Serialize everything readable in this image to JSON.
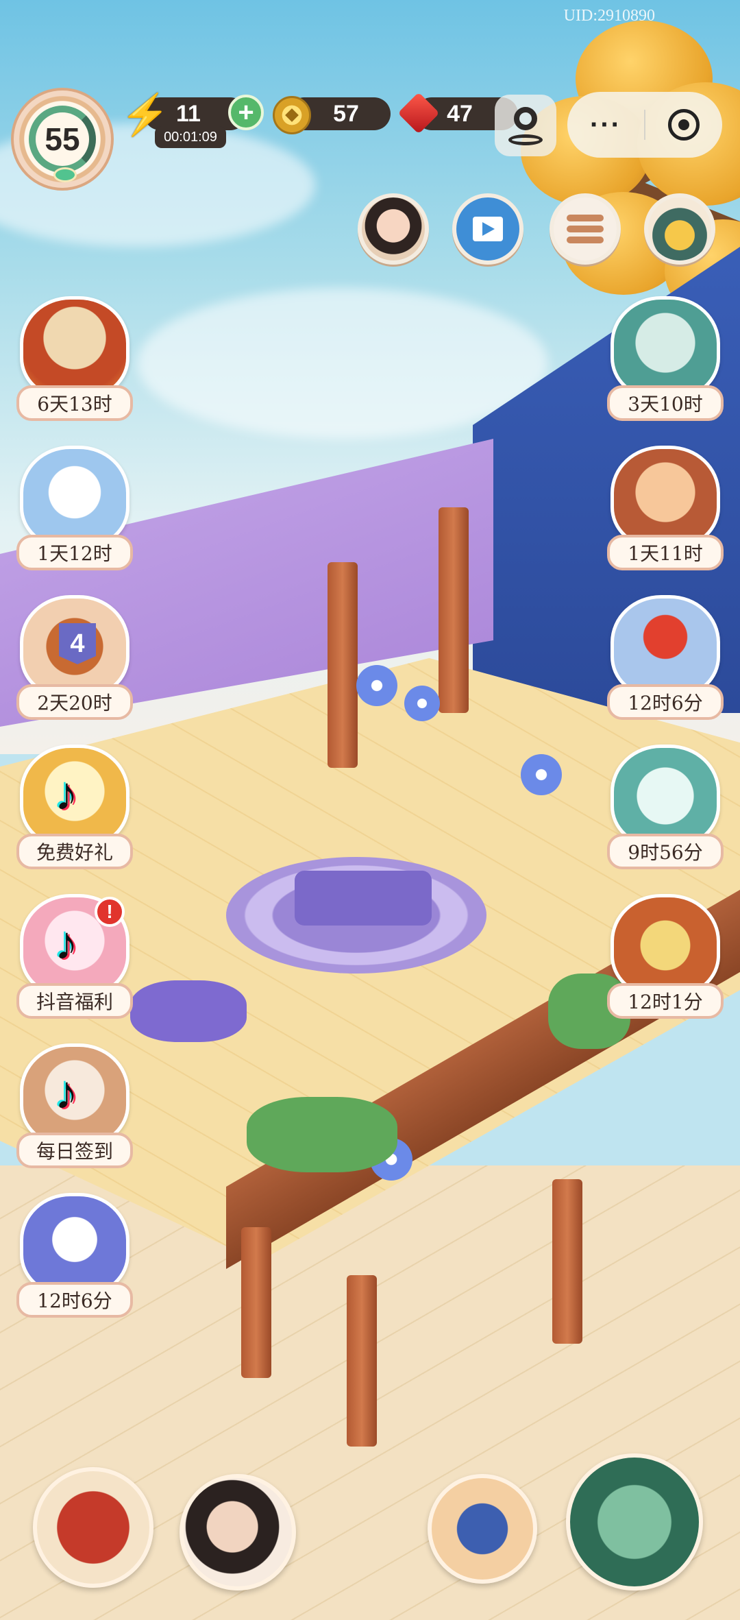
{
  "uid": "UID:2910890",
  "player": {
    "level": "55"
  },
  "resources": {
    "energy": "11",
    "energy_timer": "00:01:09",
    "coins": "57",
    "gems": "47"
  },
  "colors": {
    "accent_green": "#55b86a",
    "pill_dark": "#3b312c",
    "label_border": "#e7b9a3"
  },
  "left_events": [
    {
      "icon": "autumn-letters-icon",
      "timer": "6天13时"
    },
    {
      "icon": "snowman-cat-icon",
      "timer": "1天12时"
    },
    {
      "icon": "treasure-chest-icon",
      "badge": "4",
      "timer": "2天20时"
    },
    {
      "icon": "tiktok-icon",
      "timer": "免费好礼"
    },
    {
      "icon": "tiktok-icon",
      "timer": "抖音福利",
      "notification": "!"
    },
    {
      "icon": "tiktok-icon",
      "timer": "每日签到"
    },
    {
      "icon": "paper-crane-icon",
      "timer": "12时6分"
    }
  ],
  "right_events": [
    {
      "icon": "bath-cat-icon",
      "timer": "3天10时"
    },
    {
      "icon": "fan-cat-icon",
      "timer": "1天11时"
    },
    {
      "icon": "red-fan-icon",
      "timer": "12时6分"
    },
    {
      "icon": "gift-bear-icon",
      "timer": "9时56分"
    },
    {
      "icon": "cards-icon",
      "timer": "12时1分"
    }
  ],
  "top_buttons": [
    "avatar",
    "video-icon",
    "list-icon",
    "shop-icon"
  ],
  "bottom_icons": [
    "journal-book-icon",
    "character-portrait-icon",
    "pavilion-icon",
    "teapot-icon"
  ]
}
